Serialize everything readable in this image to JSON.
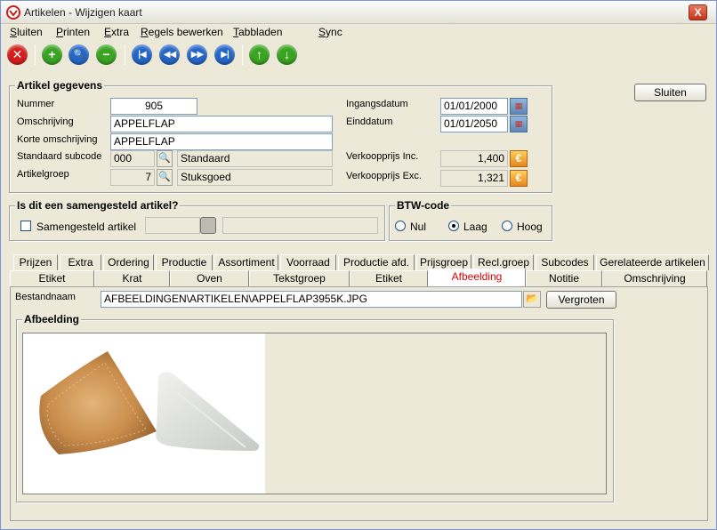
{
  "window": {
    "title": "Artikelen - Wijzigen kaart",
    "close_glyph": "X"
  },
  "menu": [
    "Sluiten",
    "Printen",
    "Extra",
    "Regels bewerken",
    "Tabbladen",
    "Sync"
  ],
  "toolbar": {
    "buttons": [
      {
        "name": "cancel",
        "icon": "close-icon",
        "glyph": "✕",
        "color": "red"
      },
      {
        "name": "add",
        "icon": "plus-icon",
        "glyph": "+",
        "color": "green"
      },
      {
        "name": "search",
        "icon": "search-icon",
        "glyph": "🔍",
        "color": "blue"
      },
      {
        "name": "remove",
        "icon": "minus-icon",
        "glyph": "−",
        "color": "green"
      },
      {
        "name": "first",
        "icon": "first-record-icon",
        "glyph": "|◀",
        "color": "blue"
      },
      {
        "name": "previous",
        "icon": "previous-record-icon",
        "glyph": "◀◀",
        "color": "blue"
      },
      {
        "name": "next",
        "icon": "next-record-icon",
        "glyph": "▶▶",
        "color": "blue"
      },
      {
        "name": "last",
        "icon": "last-record-icon",
        "glyph": "▶|",
        "color": "blue"
      },
      {
        "name": "move-up",
        "icon": "arrow-up-icon",
        "glyph": "↑",
        "color": "green"
      },
      {
        "name": "move-down",
        "icon": "arrow-down-icon",
        "glyph": "↓",
        "color": "green"
      }
    ]
  },
  "sluiten_button": "Sluiten",
  "artikel": {
    "title": "Artikel gegevens",
    "nummer_label": "Nummer",
    "nummer": "905",
    "omschrijving_label": "Omschrijving",
    "omschrijving": "APPELFLAP",
    "korte_label": "Korte omschrijving",
    "korte": "APPELFLAP",
    "subcode_label": "Standaard subcode",
    "subcode": "000",
    "subcode_desc": "Standaard",
    "groep_label": "Artikelgroep",
    "groep": "7",
    "groep_desc": "Stuksgoed",
    "ingang_label": "Ingangsdatum",
    "ingang": "01/01/2000",
    "eind_label": "Einddatum",
    "eind": "01/01/2050",
    "inc_label": "Verkoopprijs Inc.",
    "inc": "1,400",
    "exc_label": "Verkoopprijs Exc.",
    "exc": "1,321",
    "cal_glyph": "▦",
    "euro_glyph": "€",
    "pick_glyph": "🔍"
  },
  "samengesteld": {
    "title": "Is dit een samengesteld artikel?",
    "check_label": "Samengesteld artikel"
  },
  "btw": {
    "title": "BTW-code",
    "options": [
      "Nul",
      "Laag",
      "Hoog"
    ],
    "selected": "Laag"
  },
  "tabs_row1": [
    "Prijzen",
    "Extra",
    "Ordering",
    "Productie",
    "Assortiment",
    "Voorraad",
    "Productie afd.",
    "Prijsgroep",
    "Recl.groep",
    "Subcodes",
    "Gerelateerde artikelen"
  ],
  "tabs_row2": [
    "Etiket",
    "Krat",
    "Oven",
    "Tekstgroep",
    "Etiket",
    "Afbeelding",
    "Notitie",
    "Omschrijving"
  ],
  "active_tab": "Afbeelding",
  "afbeelding": {
    "bestand_label": "Bestandnaam",
    "bestand": "AFBEELDINGEN\\ARTIKELEN\\APPELFLAP3955K.JPG",
    "vergroten": "Vergroten",
    "title": "Afbeelding",
    "folder_glyph": "📂"
  },
  "colors": {
    "accent_red": "#d00000",
    "window_bg": "#ece9d8"
  }
}
